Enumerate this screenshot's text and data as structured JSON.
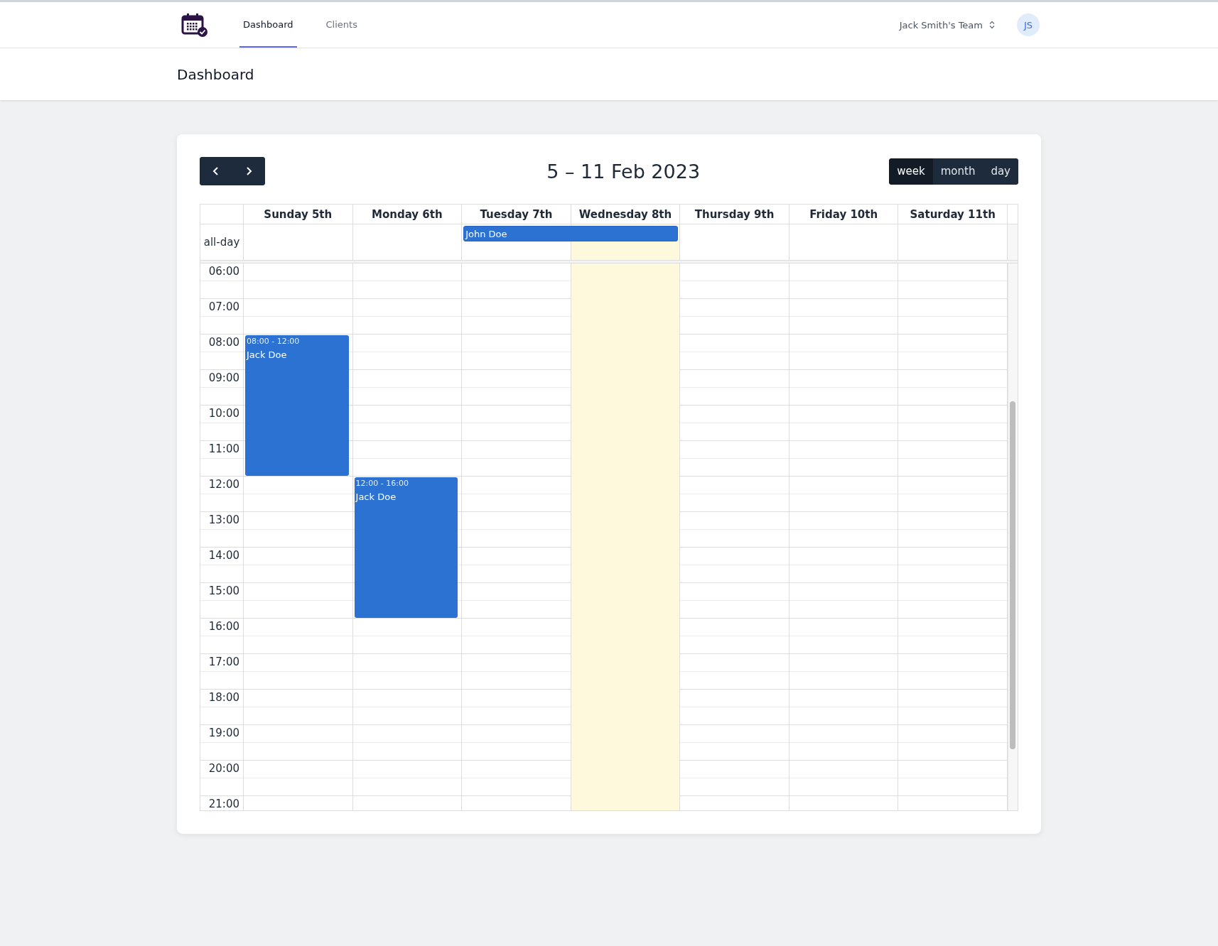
{
  "nav": {
    "tabs": [
      {
        "label": "Dashboard",
        "selected": true
      },
      {
        "label": "Clients",
        "selected": false
      }
    ],
    "team": "Jack Smith's Team",
    "avatar": "JS"
  },
  "page_title": "Dashboard",
  "calendar": {
    "title": "5 – 11 Feb 2023",
    "views": [
      {
        "label": "week",
        "selected": true
      },
      {
        "label": "month",
        "selected": false
      },
      {
        "label": "day",
        "selected": false
      }
    ],
    "allday_label": "all-day",
    "days": [
      {
        "label": "Sunday 5th",
        "today": false,
        "events": [
          {
            "time": "08:00 - 12:00",
            "title": "Jack Doe"
          }
        ]
      },
      {
        "label": "Monday 6th",
        "today": false,
        "events": [
          {
            "time": "12:00 - 16:00",
            "title": "Jack Doe"
          }
        ]
      },
      {
        "label": "Tuesday 7th",
        "today": false,
        "allday_event": {
          "title": "John Doe"
        }
      },
      {
        "label": "Wednesday 8th",
        "today": true,
        "allday_event": {
          "continued": true
        }
      },
      {
        "label": "Thursday 9th",
        "today": false
      },
      {
        "label": "Friday 10th",
        "today": false
      },
      {
        "label": "Saturday 11th",
        "today": false
      }
    ],
    "hours": [
      "06:00",
      "07:00",
      "08:00",
      "09:00",
      "10:00",
      "11:00",
      "12:00",
      "13:00",
      "14:00",
      "15:00",
      "16:00",
      "17:00",
      "18:00",
      "19:00",
      "20:00",
      "21:00"
    ]
  }
}
